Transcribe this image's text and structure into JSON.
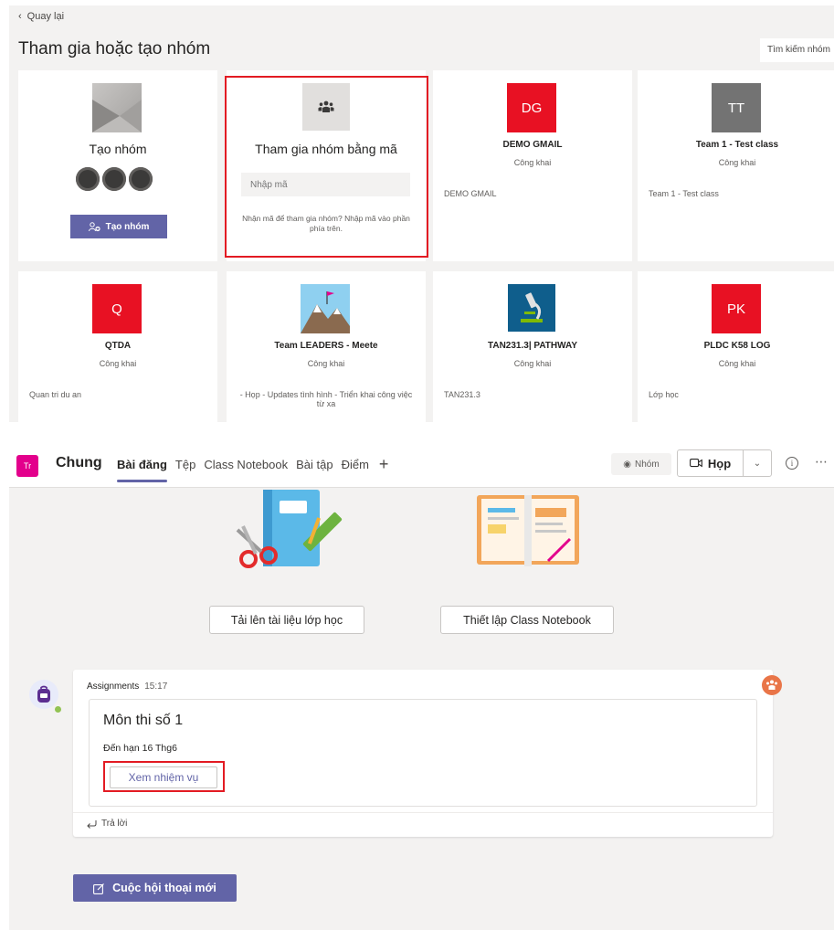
{
  "teams_page": {
    "back_label": "Quay lại",
    "title": "Tham gia hoặc tạo nhóm",
    "search_placeholder": "Tìm kiếm nhóm",
    "create_card": {
      "title": "Tạo nhóm",
      "button_label": "Tạo nhóm"
    },
    "join_card": {
      "title": "Tham gia nhóm bằng mã",
      "input_placeholder": "Nhập mã",
      "hint": "Nhận mã để tham gia nhóm? Nhập mã vào phần phía trên."
    },
    "teams": [
      {
        "avatar_text": "DG",
        "avatar_color": "#e81123",
        "name": "DEMO GMAIL",
        "visibility": "Công khai",
        "description": "DEMO GMAIL"
      },
      {
        "avatar_text": "TT",
        "avatar_color": "#737373",
        "name": "Team 1 - Test class",
        "visibility": "Công khai",
        "description": "Team 1 - Test class"
      },
      {
        "avatar_text": "Q",
        "avatar_color": "#e81123",
        "name": "QTDA",
        "visibility": "Công khai",
        "description": "Quan tri du an"
      },
      {
        "avatar_text": "",
        "avatar_icon": "mountain-flag-icon",
        "name": "Team LEADERS - Meete",
        "visibility": "Công khai",
        "description": "- Họp - Updates tình hình - Triển khai công việc từ xa"
      },
      {
        "avatar_text": "",
        "avatar_icon": "microscope-icon",
        "name": "TAN231.3| PATHWAY",
        "visibility": "Công khai",
        "description": "TAN231.3"
      },
      {
        "avatar_text": "PK",
        "avatar_color": "#e81123",
        "name": "PLDC K58 LOG",
        "visibility": "Công khai",
        "description": "Lớp học"
      }
    ]
  },
  "channel": {
    "team_badge": "Tr",
    "name": "Chung",
    "tabs": [
      "Bài đăng",
      "Tệp",
      "Class Notebook",
      "Bài tập",
      "Điểm"
    ],
    "team_pill": "Nhóm",
    "meet_label": "Họp",
    "upload_button": "Tải lên tài liệu lớp học",
    "notebook_button": "Thiết lập Class Notebook",
    "post": {
      "author": "Assignments",
      "time": "15:17",
      "assignment_title": "Môn thi số 1",
      "due": "Đến hạn 16 Thg6",
      "view_button": "Xem nhiệm vụ",
      "reply_label": "Trả lời"
    },
    "new_conversation_button": "Cuộc hội thoại mới"
  },
  "colors": {
    "accent": "#6264a7",
    "highlight": "#e31b23",
    "team_badge": "#e3008c"
  }
}
